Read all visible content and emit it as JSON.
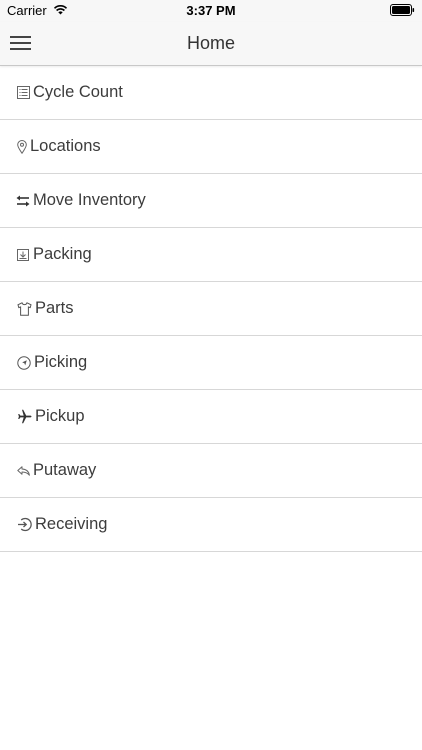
{
  "status_bar": {
    "carrier": "Carrier",
    "time": "3:37 PM"
  },
  "header": {
    "title": "Home"
  },
  "menu": {
    "items": [
      {
        "label": "Cycle Count",
        "icon": "list-icon"
      },
      {
        "label": "Locations",
        "icon": "map-pin-icon"
      },
      {
        "label": "Move Inventory",
        "icon": "swap-arrows-icon"
      },
      {
        "label": "Packing",
        "icon": "box-download-icon"
      },
      {
        "label": "Parts",
        "icon": "shirt-icon"
      },
      {
        "label": "Picking",
        "icon": "compass-icon"
      },
      {
        "label": "Pickup",
        "icon": "airplane-icon"
      },
      {
        "label": "Putaway",
        "icon": "reply-icon"
      },
      {
        "label": "Receiving",
        "icon": "sign-in-icon"
      }
    ]
  }
}
